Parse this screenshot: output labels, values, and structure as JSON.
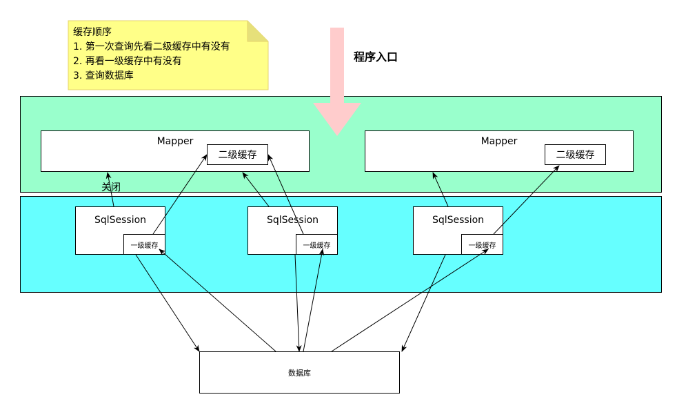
{
  "note": {
    "line1": "缓存顺序",
    "line2": "1. 第一次查询先看二级缓存中有没有",
    "line3": "2. 再看一级缓存中有没有",
    "line4": "3. 查询数据库"
  },
  "entry_label": "程序入口",
  "mappers": [
    {
      "label": "Mapper",
      "cache_label": "二级缓存"
    },
    {
      "label": "Mapper",
      "cache_label": "二级缓存"
    }
  ],
  "sessions": [
    {
      "label": "SqlSession",
      "cache_label": "一级缓存"
    },
    {
      "label": "SqlSession",
      "cache_label": "一级缓存"
    },
    {
      "label": "SqlSession",
      "cache_label": "一级缓存"
    }
  ],
  "close_label": "关闭",
  "database_label": "数据库",
  "colors": {
    "note_fill": "#ffff88",
    "mapper_band": "#99ffcc",
    "session_band": "#66ffff",
    "entry_arrow": "#ffcccc"
  }
}
